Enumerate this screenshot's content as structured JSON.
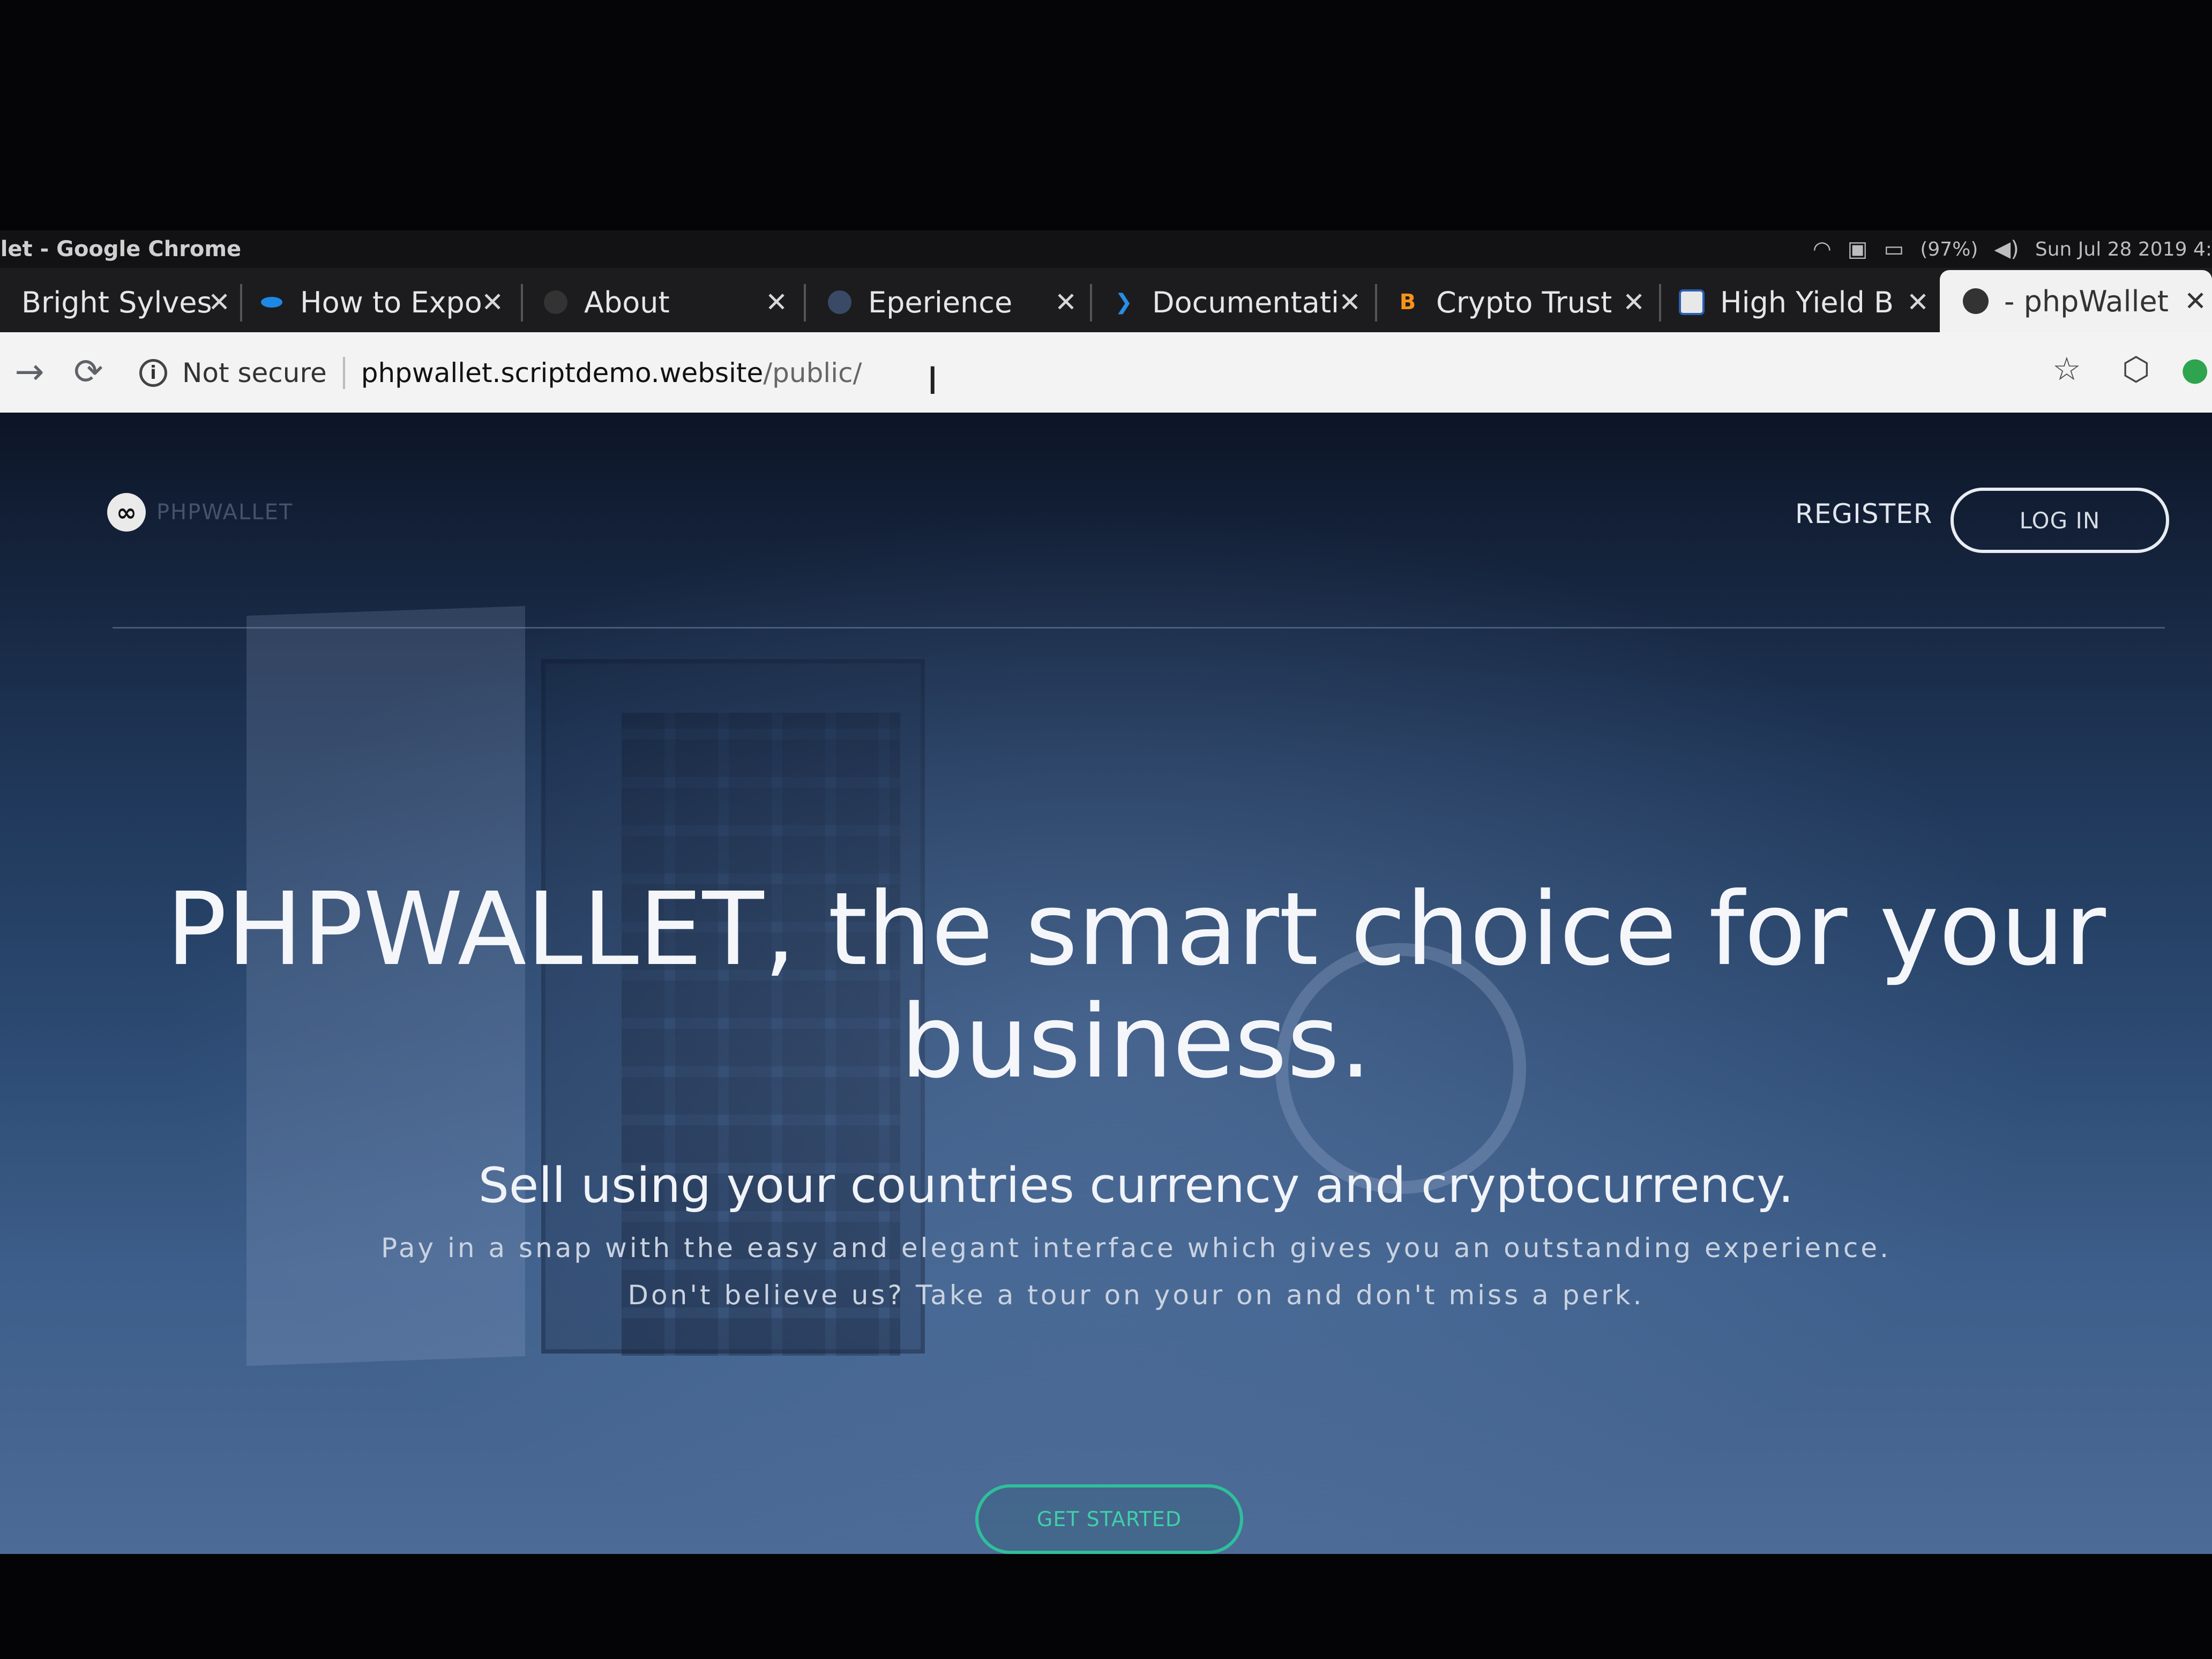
{
  "os": {
    "window_title": "allet - Google Chrome",
    "battery": "(97%)",
    "clock": "Sun Jul 28 2019 4:"
  },
  "tabs": [
    {
      "title": "Bright Sylves",
      "favicon": "none"
    },
    {
      "title": "How to Expo",
      "favicon": "dot-icon"
    },
    {
      "title": "About",
      "favicon": "globe-icon"
    },
    {
      "title": "Eperience",
      "favicon": "globe-icon"
    },
    {
      "title": "Documentati",
      "favicon": "vscode-icon"
    },
    {
      "title": "Crypto Trust",
      "favicon": "bitcoin-icon"
    },
    {
      "title": "High Yield B",
      "favicon": "shield-icon"
    },
    {
      "title": "- phpWallet",
      "favicon": "globe-icon",
      "active": true
    }
  ],
  "tab_close_glyph": "✕",
  "toolbar": {
    "forward_glyph": "→",
    "reload_glyph": "⟳",
    "security_label": "Not secure",
    "url_host": "phpwallet.scriptdemo.website",
    "url_path": "/public/"
  },
  "site": {
    "brand_text": "PHPWALLET",
    "nav_register": "REGISTER",
    "nav_login": "LOG IN",
    "hero_title": "PHPWALLET, the smart choice for your business.",
    "hero_subtitle": "Sell using your countries currency and cryptocurrency.",
    "hero_line1": "Pay in a snap with the easy and elegant interface which gives you an outstanding experience.",
    "hero_line2": "Don't believe us? Take a tour on your on and don't miss a perk.",
    "cta": "GET STARTED"
  },
  "colors": {
    "accent_green": "#2fbf9a",
    "hero_bg": "#2c4a72"
  }
}
